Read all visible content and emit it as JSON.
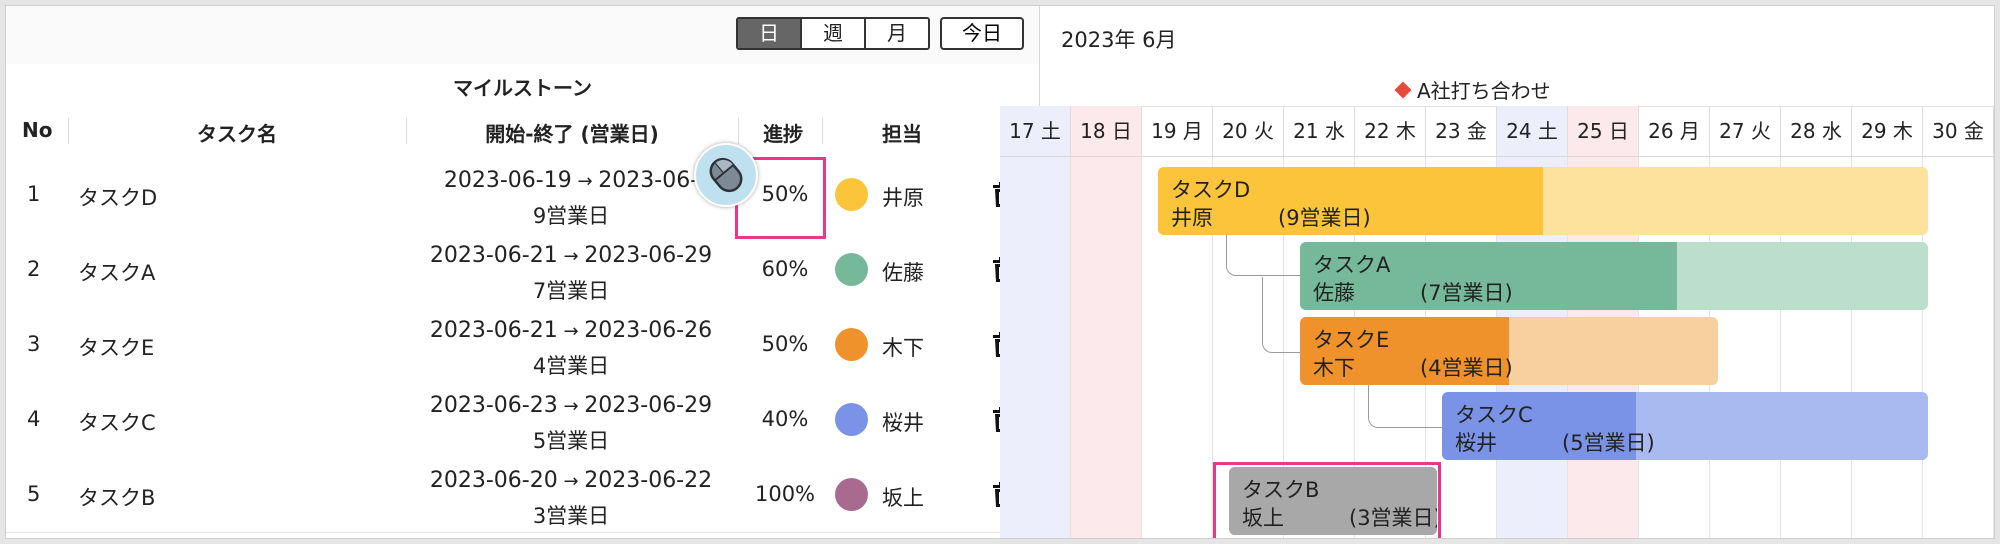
{
  "toolbar": {
    "view_buttons": [
      "日",
      "週",
      "月"
    ],
    "today_label": "今日"
  },
  "month_label": "2023年 6月",
  "milestone": {
    "header": "マイルストーン",
    "label": "A社打ち合わせ"
  },
  "columns": {
    "no": "No",
    "name": "タスク名",
    "dates": "開始-終了 (営業日)",
    "progress": "進捗",
    "owner": "担当"
  },
  "tasks": [
    {
      "no": "1",
      "name": "タスクD",
      "start": "2023-06-19",
      "end": "2023-06-",
      "days": "9営業日",
      "progress": "50%",
      "owner": "井原",
      "color": "#fbc43a",
      "light": "#fde29e"
    },
    {
      "no": "2",
      "name": "タスクA",
      "start": "2023-06-21",
      "end": "2023-06-29",
      "days": "7営業日",
      "progress": "60%",
      "owner": "佐藤",
      "color": "#76b99a",
      "light": "#bbdfcc"
    },
    {
      "no": "3",
      "name": "タスクE",
      "start": "2023-06-21",
      "end": "2023-06-26",
      "days": "4営業日",
      "progress": "50%",
      "owner": "木下",
      "color": "#ef922c",
      "light": "#f8d09f"
    },
    {
      "no": "4",
      "name": "タスクC",
      "start": "2023-06-23",
      "end": "2023-06-29",
      "days": "5営業日",
      "progress": "40%",
      "owner": "桜井",
      "color": "#7a93e6",
      "light": "#a9baf1"
    },
    {
      "no": "5",
      "name": "タスクB",
      "start": "2023-06-20",
      "end": "2023-06-22",
      "days": "3営業日",
      "progress": "100%",
      "owner": "坂上",
      "color": "#a86b8f",
      "light": "#a86b8f"
    }
  ],
  "gantt_bars": [
    {
      "name": "タスクD",
      "owner": "井原",
      "days": "(9営業日)",
      "progress": 0.5,
      "color": "#fbc43a",
      "light": "#fde29e"
    },
    {
      "name": "タスクA",
      "owner": "佐藤",
      "days": "(7営業日)",
      "progress": 0.6,
      "color": "#76b99a",
      "light": "#bbdfcc"
    },
    {
      "name": "タスクE",
      "owner": "木下",
      "days": "(4営業日)",
      "progress": 0.5,
      "color": "#ef922c",
      "light": "#f8d09f"
    },
    {
      "name": "タスクC",
      "owner": "桜井",
      "days": "(5営業日)",
      "progress": 0.4,
      "color": "#7a93e6",
      "light": "#a9baf1"
    },
    {
      "name": "タスクB",
      "owner": "坂上",
      "days": "(3営業日)",
      "progress": 1.0,
      "color": "#a8a8a8",
      "light": "#a8a8a8"
    }
  ],
  "days": [
    {
      "label": "17 土",
      "kind": "sat"
    },
    {
      "label": "18 日",
      "kind": "sun"
    },
    {
      "label": "19 月",
      "kind": "wd"
    },
    {
      "label": "20 火",
      "kind": "wd"
    },
    {
      "label": "21 水",
      "kind": "wd"
    },
    {
      "label": "22 木",
      "kind": "wd"
    },
    {
      "label": "23 金",
      "kind": "wd"
    },
    {
      "label": "24 土",
      "kind": "sat"
    },
    {
      "label": "25 日",
      "kind": "sun"
    },
    {
      "label": "26 月",
      "kind": "wd"
    },
    {
      "label": "27 火",
      "kind": "wd"
    },
    {
      "label": "28 水",
      "kind": "wd"
    },
    {
      "label": "29 木",
      "kind": "wd"
    },
    {
      "label": "30 金",
      "kind": "wd"
    }
  ],
  "colors": {
    "highlight": "#e8388a",
    "saturday_bg": "#eceefb",
    "sunday_bg": "#fbe9ec",
    "milestone_marker": "#e8483c"
  },
  "icons": {
    "trash": "trash-icon",
    "cursor": "mouse-icon",
    "milestone": "diamond-icon"
  }
}
